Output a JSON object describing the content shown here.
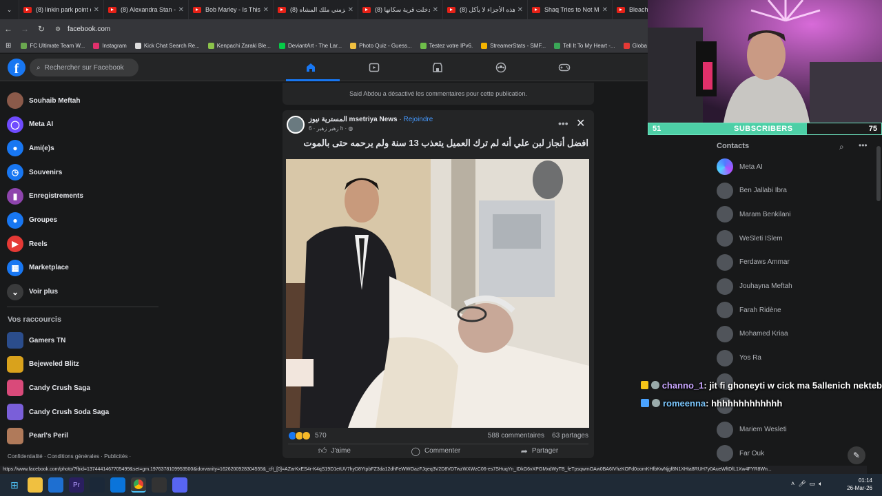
{
  "browser": {
    "tabs": [
      {
        "title": "(8) linkin park point o"
      },
      {
        "title": "(8) Alexandra Stan - I"
      },
      {
        "title": "Bob Marley - Is This L"
      },
      {
        "title": "(8) الزمني ملك المشاه"
      },
      {
        "title": "(8) دخلت قرية سكانها"
      },
      {
        "title": "(8) هذه الأجزاء لا يأكل"
      },
      {
        "title": "Shaq Tries to Not Me"
      },
      {
        "title": "Bleach: T"
      }
    ],
    "url": "facebook.com",
    "bookmarks": [
      "FC Ultimate Team W...",
      "Instagram",
      "Kick Chat Search Re...",
      "Kenpachi Zaraki Ble...",
      "DeviantArt - The Lar...",
      "Photo Quiz - Guess...",
      "Testez votre IPv6.",
      "StreamerStats - SMF...",
      "Tell It To My Heart -...",
      "Globa"
    ],
    "status_url": "https://www.facebook.com/photo/?fbid=1374441467705499&set=gm.1976378109953500&idorvanity=1626200928304555&_cft_[0]=AZarKxES4r-K4qS19D1etUV7hyD8YtpbFZ3da12dhFeWWOazFJqeq3V2D8VDTwzWXWzC06-es7SHuqYn_IDkG6vXPGMxdWyTB_feTpsqwmOAw0BA6IVhzKOFd0oomKHfbKwNjgf8N1XHta8RUH7y0AueWftDfL1Xw4FYR8Wn..."
  },
  "facebook": {
    "search_placeholder": "Rechercher sur Facebook",
    "sidebar": [
      {
        "label": "Souhaib Meftah",
        "icon": "profile-avatar-icon",
        "color": "#8b5a4a"
      },
      {
        "label": "Meta AI",
        "icon": "meta-ai-icon",
        "color": "#6f4bff"
      },
      {
        "label": "Ami(e)s",
        "icon": "friends-icon",
        "color": "#1877f2"
      },
      {
        "label": "Souvenirs",
        "icon": "memories-clock-icon",
        "color": "#1877f2"
      },
      {
        "label": "Enregistrements",
        "icon": "bookmark-icon",
        "color": "#8e44ad"
      },
      {
        "label": "Groupes",
        "icon": "groups-icon",
        "color": "#1877f2"
      },
      {
        "label": "Reels",
        "icon": "reels-icon",
        "color": "#e53935"
      },
      {
        "label": "Marketplace",
        "icon": "marketplace-icon",
        "color": "#1877f2"
      },
      {
        "label": "Voir plus",
        "icon": "chevron-down-icon",
        "color": "#3a3b3c"
      }
    ],
    "shortcuts_title": "Vos raccourcis",
    "shortcuts": [
      {
        "label": "Gamers TN",
        "color": "#2b4d8c"
      },
      {
        "label": "Bejeweled Blitz",
        "color": "#d9a21c"
      },
      {
        "label": "Candy Crush Saga",
        "color": "#d94a7a"
      },
      {
        "label": "Candy Crush Soda Saga",
        "color": "#7a5fd9"
      },
      {
        "label": "Pearl's Peril",
        "color": "#b07a5a"
      }
    ],
    "footer": "Confidentialité · Conditions générales · Publicités ·",
    "comments_disabled": "Said Abdou a désactivé les commentaires pour cette publication.",
    "post": {
      "page_name": "المسترية نيوز msetriya News",
      "join": "Rejoindre",
      "meta": "زهير زهير · 6 h · ",
      "caption": "افضل أنجاز لبن علي أنه لم ترك العميل يتعذب 13 سنة ولم يرحمه حتى بالموت",
      "reactions_count": "570",
      "comments_count": "588 commentaires",
      "shares_count": "63 partages",
      "like_label": "J'aime",
      "comment_label": "Commenter",
      "share_label": "Partager"
    },
    "contacts_title": "Contacts",
    "contacts": [
      "Meta AI",
      "Ben Jallabi Ibra",
      "Maram Benkilani",
      "WeSleti ISlem",
      "Ferdaws Ammar",
      "Jouhayna Meftah",
      "Farah Ridène",
      "Mohamed Kriaa",
      "Yos Ra",
      "",
      "",
      "Mariem Wesleti",
      "Far Ouk"
    ]
  },
  "stream_overlay": {
    "subscribers_current": "51",
    "subscribers_label": "SUBSCRIBERS",
    "subscribers_goal": "75",
    "subscribers_progress": 0.68,
    "chat": [
      {
        "user": "channo_1",
        "message": " : jit fi ghoneyti w cick ma 5allenich nekteb",
        "color": "#c9a6ff"
      },
      {
        "user": "romeenna",
        "message": " : hhhhhhhhhhhhh",
        "color": "#7cc8ff"
      }
    ]
  },
  "taskbar": {
    "time": "01:14",
    "date": "26-Mar-26"
  }
}
